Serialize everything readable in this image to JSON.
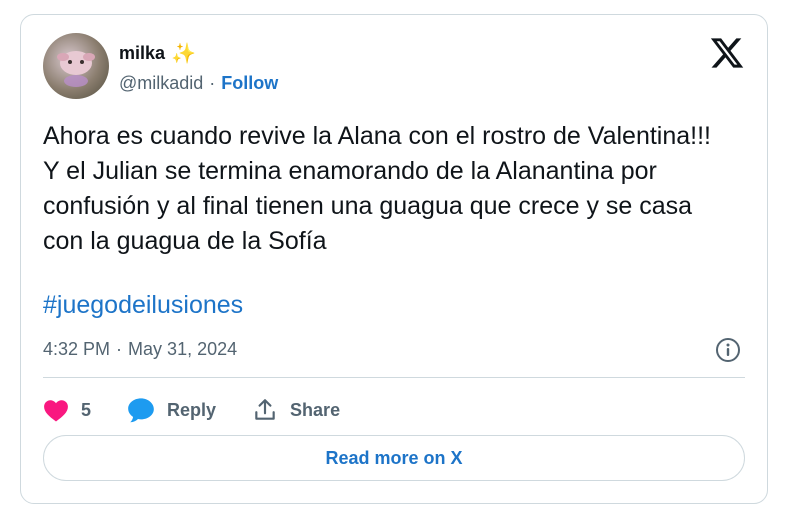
{
  "author": {
    "display_name": "milka",
    "name_emoji": "✨",
    "handle": "@milkadid",
    "separator": "·",
    "follow_label": "Follow"
  },
  "tweet": {
    "text": "Ahora es cuando revive la Alana con el rostro de Valentina!!! Y el Julian se termina enamorando de la Alanantina por confusión y al final tienen una guagua que crece y se casa con la guagua de la Sofía",
    "hashtag": "#juegodeilusiones",
    "time": "4:32 PM",
    "date_separator": "·",
    "date": "May 31, 2024"
  },
  "actions": {
    "like_count": "5",
    "reply_label": "Reply",
    "share_label": "Share"
  },
  "read_more_label": "Read more on X",
  "icons": {
    "logo": "x-logo-icon",
    "info": "info-icon",
    "like": "heart-icon",
    "reply": "speech-bubble-icon",
    "share": "upload-icon"
  },
  "colors": {
    "link": "#1d74c8",
    "heart": "#f91880",
    "reply_bubble": "#1d9bf0",
    "muted": "#536471",
    "border": "#cfd9de"
  }
}
